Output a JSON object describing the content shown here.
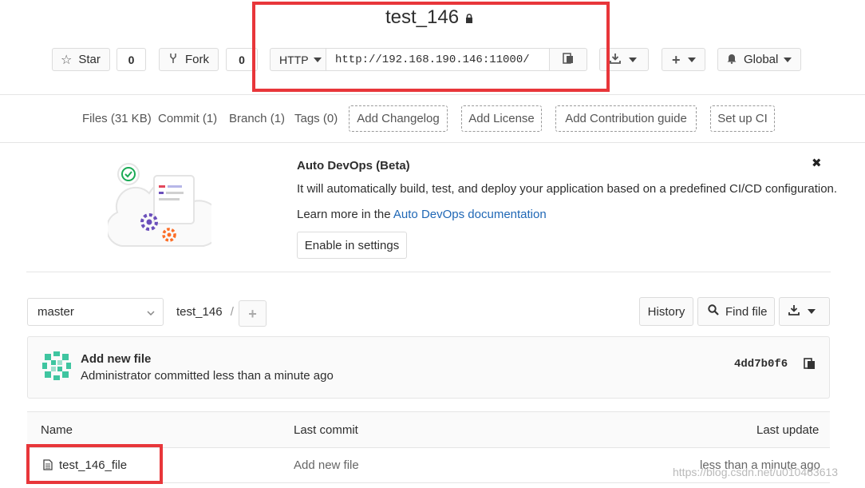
{
  "project": {
    "name": "test_146"
  },
  "header": {
    "star": {
      "label": "Star",
      "count": "0"
    },
    "fork": {
      "label": "Fork",
      "count": "0"
    },
    "clone": {
      "protocol": "HTTP",
      "url": "http://192.168.190.146:11000/"
    },
    "notification": "Global"
  },
  "stats": {
    "files": "Files (31 KB)",
    "commits": "Commit (1)",
    "branches": "Branch (1)",
    "tags": "Tags (0)",
    "add_changelog": "Add Changelog",
    "add_license": "Add License",
    "add_contribution": "Add Contribution guide",
    "setup_ci": "Set up CI"
  },
  "devops": {
    "title": "Auto DevOps (Beta)",
    "description": "It will automatically build, test, and deploy your application based on a predefined CI/CD configuration.",
    "learn_prefix": "Learn more in the ",
    "learn_link": "Auto DevOps documentation",
    "enable_button": "Enable in settings",
    "close": "✖"
  },
  "tree": {
    "branch": "master",
    "path": "test_146",
    "separator": "/",
    "history": "History",
    "find_file": "Find file"
  },
  "commit": {
    "message": "Add new file",
    "author_line": "Administrator committed less than a minute ago",
    "sha": "4dd7b0f6"
  },
  "table": {
    "headers": {
      "name": "Name",
      "last_commit": "Last commit",
      "last_update": "Last update"
    },
    "rows": [
      {
        "name": "test_146_file",
        "commit": "Add new file",
        "update": "less than a minute ago"
      }
    ]
  },
  "watermark": "https://blog.csdn.net/u010463613",
  "colors": {
    "highlight": "#e8363a",
    "link": "#1f67b5",
    "success": "#1aaa55"
  }
}
